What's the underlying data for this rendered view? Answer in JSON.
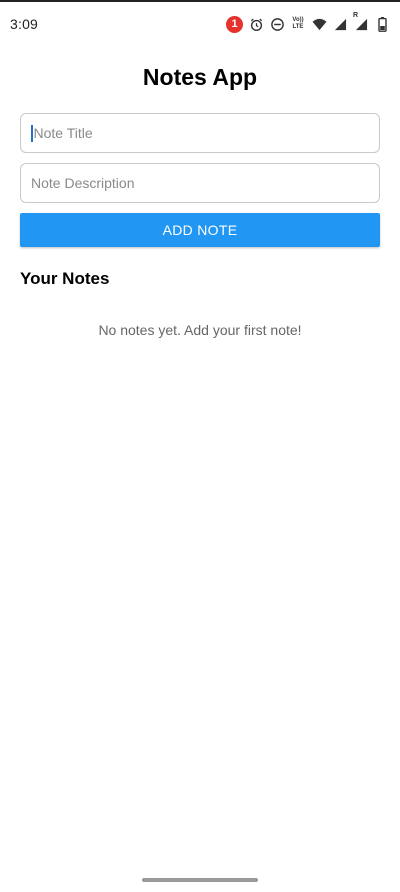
{
  "status_bar": {
    "time": "3:09",
    "notification_count": "1",
    "volte_label": "Vo)) LTE",
    "signal_r_label": "R",
    "icons": [
      "notification-badge",
      "alarm-icon",
      "do-not-disturb-icon",
      "volte-icon",
      "wifi-icon",
      "cellular-signal-icon",
      "cellular-signal-roaming-icon",
      "battery-icon"
    ]
  },
  "app": {
    "title": "Notes App"
  },
  "form": {
    "title_placeholder": "Note Title",
    "title_value": "",
    "description_placeholder": "Note Description",
    "description_value": "",
    "add_button_label": "ADD NOTE"
  },
  "notes_section": {
    "heading": "Your Notes",
    "empty_message": "No notes yet. Add your first note!",
    "notes": []
  },
  "colors": {
    "accent": "#2196f3",
    "badge": "#e5322d",
    "background": "#ffffff"
  }
}
